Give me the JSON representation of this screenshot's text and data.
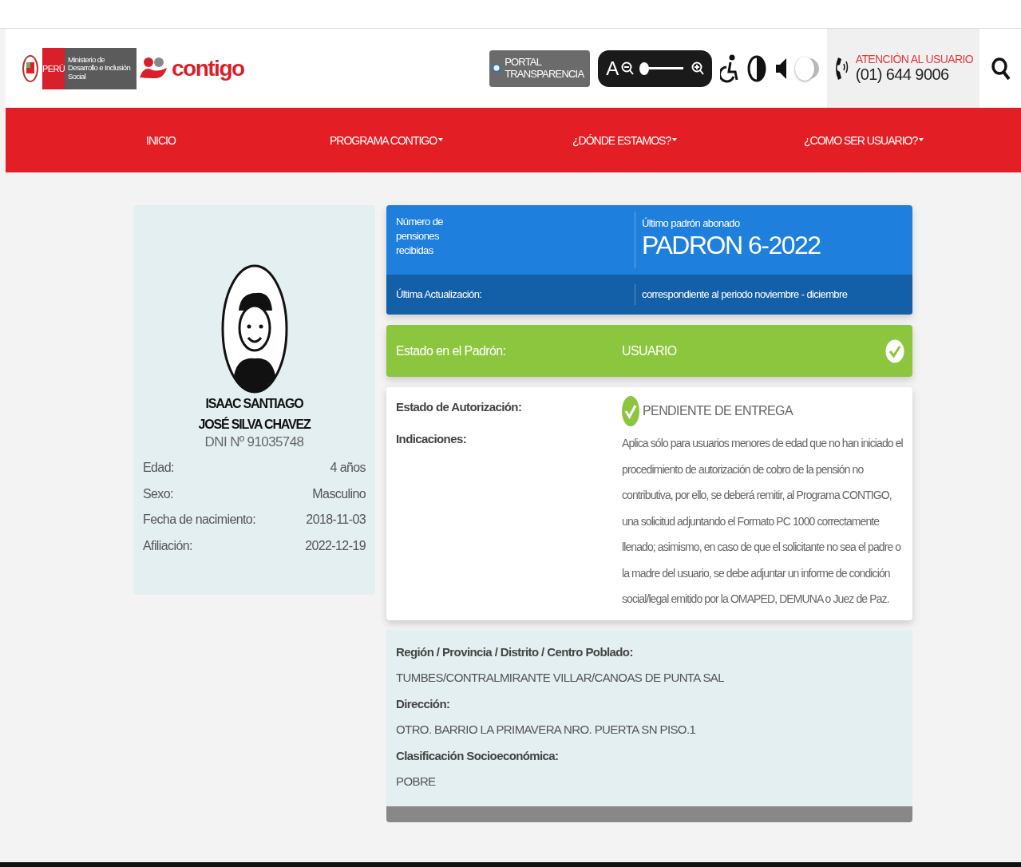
{
  "header": {
    "gov_label": "PERÚ",
    "ministry": "Ministerio de Desarrollo e Inclusión Social",
    "brand": "contigo",
    "portal": "PORTAL TRANSPARENCIA",
    "font_slider": {
      "letter": "A",
      "level": 0
    },
    "audio_toggle": {
      "on": false
    },
    "support": {
      "title": "ATENCIÓN AL USUARIO",
      "phone": "(01) 644 9006"
    }
  },
  "nav": [
    {
      "label": "INICIO",
      "dropdown": false
    },
    {
      "label": "PROGRAMA CONTIGO",
      "dropdown": true
    },
    {
      "label": "¿DÓNDE ESTAMOS?",
      "dropdown": true
    },
    {
      "label": "¿COMO SER USUARIO?",
      "dropdown": true
    }
  ],
  "profile": {
    "name": "ISAAC SANTIAGO JOSÉ SILVA CHAVEZ",
    "dni": "DNI Nº 91035748",
    "fields": [
      {
        "label": "Edad:",
        "value": "4 años"
      },
      {
        "label": "Sexo:",
        "value": "Masculino"
      },
      {
        "label": "Fecha de nacimiento:",
        "value": "2018-11-03"
      },
      {
        "label": "Afiliación:",
        "value": "2022-12-19"
      }
    ]
  },
  "pension": {
    "count_label": "Número de pensiones recibidas",
    "last_label": "Último padrón abonado",
    "last_value": "PADRON 6-2022",
    "update_label": "Última Actualización:",
    "update_value": "correspondiente al periodo noviembre - diciembre"
  },
  "status": {
    "label": "Estado en el Padrón:",
    "value": "USUARIO"
  },
  "authorization": {
    "label": "Estado de Autorización:",
    "value": "PENDIENTE DE ENTREGA",
    "notes_label": "Indicaciones:",
    "notes": "Aplica sólo para usuarios menores de edad que no han iniciado el procedimiento de autorización de cobro de la pensión no contributiva, por ello, se deberá remitir, al Programa CONTIGO, una solicitud adjuntando el Formato PC 1000 correctamente llenado; asimismo, en caso de que el solicitante no sea el padre o la madre del usuario, se debe adjuntar un informe de condición social/legal emitido por la OMAPED, DEMUNA o Juez de Paz."
  },
  "location": [
    {
      "label": "Región / Provincia / Distrito / Centro Poblado:",
      "value": "TUMBES/CONTRALMIRANTE VILLAR/CANOAS DE PUNTA SAL"
    },
    {
      "label": "Dirección:",
      "value": "OTRO. BARRIO LA PRIMAVERA NRO. PUERTA SN PISO.1"
    },
    {
      "label": "Clasificación Socioeconómica:",
      "value": "POBRE"
    }
  ]
}
